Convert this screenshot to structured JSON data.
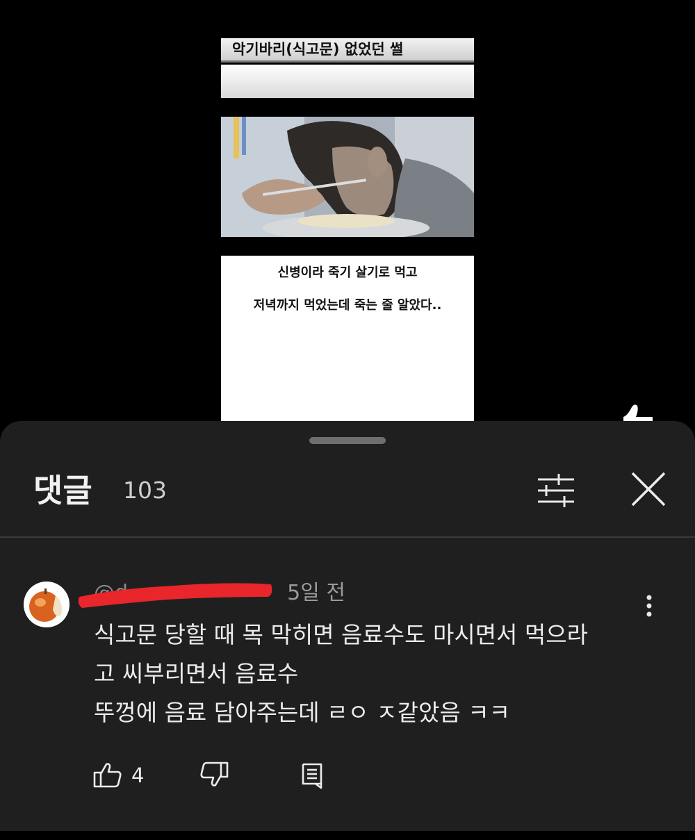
{
  "video": {
    "thumbnail_title": "악기바리(식고문) 없었던 썰",
    "thumbnail_caption_line1": "신병이라 죽기 살기로 먹고",
    "thumbnail_caption_line2": "저녁까지 먹었는데 죽는 줄 알았다.."
  },
  "comments_panel": {
    "title": "댓글",
    "count": "103",
    "filter_icon": "filter-sliders-icon",
    "close_icon": "close-icon"
  },
  "comment": {
    "handle": "@d",
    "time": "5일 전",
    "lines": [
      "식고문 당할 때 목 막히면 음료수도 마시면서 먹으라",
      "고 씨부리면서 음료수",
      "뚜껑에 음료 담아주는데 ㄹㅇ ㅈ같았음 ㅋㅋ"
    ],
    "like_count": "4",
    "redaction_color": "#e8262b"
  },
  "colors": {
    "panel_bg": "#1f1f1f",
    "text": "#ececec",
    "muted": "#9a9a9a"
  }
}
